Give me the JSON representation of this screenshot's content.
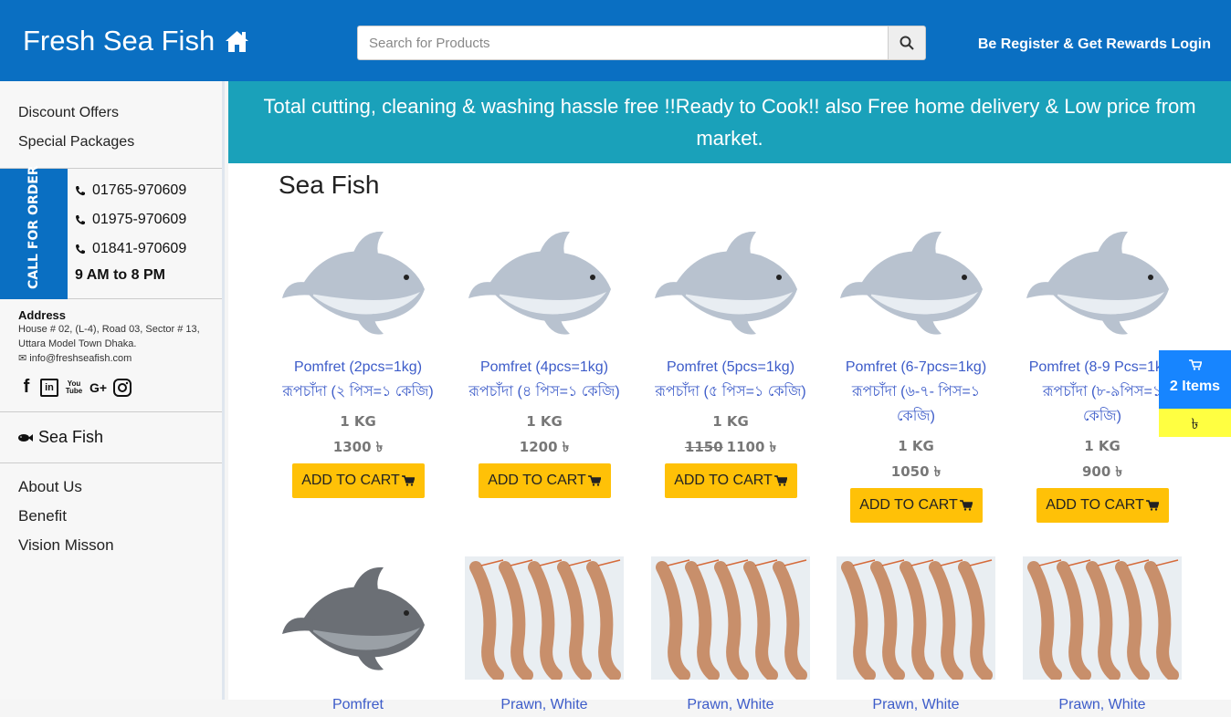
{
  "header": {
    "brand": "Fresh Sea Fish",
    "search_placeholder": "Search for Products",
    "register_link": "Be Register & Get Rewards",
    "login_link": "Login"
  },
  "sidebar": {
    "top_links": [
      "Discount Offers",
      "Special Packages"
    ],
    "call_label": "CALL FOR ORDER",
    "phones": [
      "01765-970609",
      "01975-970609",
      "01841-970609"
    ],
    "hours": "9 AM to 8 PM",
    "address_title": "Address",
    "address_text": "House # 02, (L-4), Road 03, Sector # 13, Uttara Model Town Dhaka.",
    "email": "info@freshseafish.com",
    "social": [
      "f",
      "in",
      "You Tube",
      "G+",
      "instagram-icon"
    ],
    "category": "Sea Fish",
    "bottom_links": [
      "About Us",
      "Benefit",
      "Vision Misson"
    ]
  },
  "banner": "Total cutting, cleaning & washing hassle free !!Ready to Cook!! also Free home delivery & Low price from market.",
  "section_title": "Sea Fish",
  "products": [
    {
      "name_en": "Pomfret (2pcs=1kg)",
      "name_bn": "রূপচাঁদা (২ পিস=১ কেজি)",
      "unit": "1 KG",
      "old_price": "",
      "price": "1300 ৳",
      "button": "ADD TO CART"
    },
    {
      "name_en": "Pomfret (4pcs=1kg)",
      "name_bn": "রূপচাঁদা (৪ পিস=১ কেজি)",
      "unit": "1 KG",
      "old_price": "",
      "price": "1200 ৳",
      "button": "ADD TO CART"
    },
    {
      "name_en": "Pomfret (5pcs=1kg)",
      "name_bn": "রূপচাঁদা (৫ পিস=১ কেজি)",
      "unit": "1 KG",
      "old_price": "1150",
      "price": "1100 ৳",
      "button": "ADD TO CART"
    },
    {
      "name_en": "Pomfret (6-7pcs=1kg)",
      "name_bn": "রূপচাঁদা (৬-৭- পিস=১ কেজি)",
      "unit": "1 KG",
      "old_price": "",
      "price": "1050 ৳",
      "button": "ADD TO CART"
    },
    {
      "name_en": "Pomfret (8-9 Pcs=1kg)",
      "name_bn": "রূপচাঁদা (৮-৯পিস=১ কেজি)",
      "unit": "1 KG",
      "old_price": "",
      "price": "900 ৳",
      "button": "ADD TO CART"
    }
  ],
  "products_row2": [
    {
      "name_en": "Pomfret"
    },
    {
      "name_en": "Prawn, White"
    },
    {
      "name_en": "Prawn, White"
    },
    {
      "name_en": "Prawn, White"
    },
    {
      "name_en": "Prawn, White"
    }
  ],
  "floating_cart": {
    "count": "2 Items",
    "total": "৳"
  }
}
